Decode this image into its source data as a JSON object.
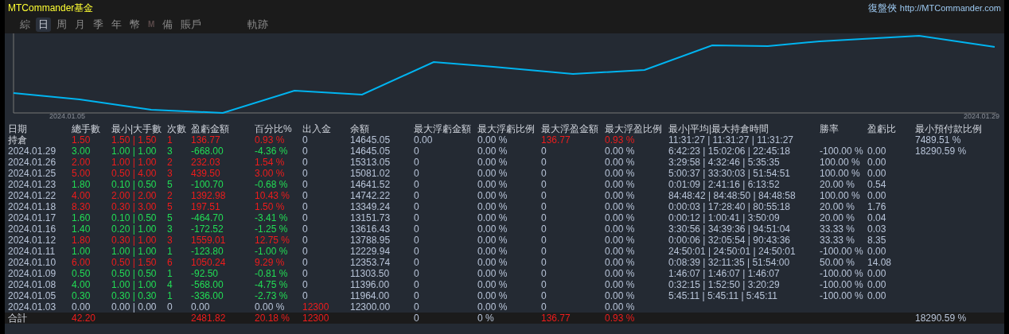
{
  "window": {
    "title": "MTCommander基金",
    "brand": "復盤俠",
    "url": "http://MTCommander.com"
  },
  "tabs": [
    {
      "label": "綜",
      "selected": false,
      "disabled": false
    },
    {
      "label": "日",
      "selected": true,
      "disabled": false
    },
    {
      "label": "周",
      "selected": false,
      "disabled": false
    },
    {
      "label": "月",
      "selected": false,
      "disabled": false
    },
    {
      "label": "季",
      "selected": false,
      "disabled": false
    },
    {
      "label": "年",
      "selected": false,
      "disabled": false
    },
    {
      "label": "幣",
      "selected": false,
      "disabled": false
    },
    {
      "label": "M",
      "selected": false,
      "disabled": true
    },
    {
      "label": "備",
      "selected": false,
      "disabled": false
    },
    {
      "label": "賬戶",
      "selected": false,
      "disabled": false
    }
  ],
  "extra_tabs": [
    {
      "label": "軌跡",
      "selected": false,
      "disabled": false
    }
  ],
  "chart": {
    "start_label": "2024.01.05",
    "end_label": "2024.01.29"
  },
  "table": {
    "columns": [
      "日期",
      "總手數",
      "最小|大手數",
      "次數",
      "盈虧金額",
      "百分比%",
      "出入金",
      "余額",
      "最大浮虧金額",
      "最大浮虧比例",
      "最大浮盈金額",
      "最大浮盈比例",
      "最小|平均|最大持倉時間",
      "勝率",
      "盈虧比",
      "最小預付款比例"
    ],
    "rows": [
      {
        "kind": "gain",
        "cash_flagged": false,
        "float_flagged": true,
        "cells": [
          "持倉",
          "1.50",
          "1.50 | 1.50",
          "1",
          "136.77",
          "0.93 %",
          "0",
          "14645.05",
          "0.00",
          "0.00 %",
          "136.77",
          "0.93 %",
          "11:31:27 | 11:31:27 | 11:31:27",
          null,
          null,
          "7489.51 %"
        ]
      },
      {
        "kind": "loss",
        "cash_flagged": false,
        "float_flagged": false,
        "cells": [
          "2024.01.29",
          "3.00",
          "1.00 | 1.00",
          "3",
          "-668.00",
          "-4.36 %",
          "0",
          "14645.05",
          "0",
          "0.00 %",
          "0",
          "0.00 %",
          "6:42:23 | 15:02:06 | 22:45:18",
          "-100.00 %",
          "0.00",
          "18290.59 %"
        ]
      },
      {
        "kind": "gain",
        "cash_flagged": false,
        "float_flagged": false,
        "cells": [
          "2024.01.26",
          "2.00",
          "1.00 | 1.00",
          "2",
          "232.03",
          "1.54 %",
          "0",
          "15313.05",
          "0",
          "0.00 %",
          "0",
          "0.00 %",
          "3:29:58 | 4:32:46 | 5:35:35",
          "100.00 %",
          "0.00",
          null
        ]
      },
      {
        "kind": "gain",
        "cash_flagged": false,
        "float_flagged": false,
        "cells": [
          "2024.01.25",
          "5.00",
          "0.50 | 4.00",
          "3",
          "439.50",
          "3.00 %",
          "0",
          "15081.02",
          "0",
          "0.00 %",
          "0",
          "0.00 %",
          "5:00:37 | 33:30:03 | 51:54:51",
          "100.00 %",
          "0.00",
          null
        ]
      },
      {
        "kind": "loss",
        "cash_flagged": false,
        "float_flagged": false,
        "cells": [
          "2024.01.23",
          "1.80",
          "0.10 | 0.50",
          "5",
          "-100.70",
          "-0.68 %",
          "0",
          "14641.52",
          "0",
          "0.00 %",
          "0",
          "0.00 %",
          "0:01:09 | 2:41:16 | 6:13:52",
          "20.00 %",
          "0.54",
          null
        ]
      },
      {
        "kind": "gain",
        "cash_flagged": false,
        "float_flagged": false,
        "cells": [
          "2024.01.22",
          "4.00",
          "2.00 | 2.00",
          "2",
          "1392.98",
          "10.43 %",
          "0",
          "14742.22",
          "0",
          "0.00 %",
          "0",
          "0.00 %",
          "84:48:42 | 84:48:50 | 84:48:58",
          "100.00 %",
          "0.00",
          null
        ]
      },
      {
        "kind": "gain",
        "cash_flagged": false,
        "float_flagged": false,
        "cells": [
          "2024.01.18",
          "8.30",
          "0.30 | 3.00",
          "5",
          "197.51",
          "1.50 %",
          "0",
          "13349.24",
          "0",
          "0.00 %",
          "0",
          "0.00 %",
          "0:00:03 | 17:28:40 | 80:55:18",
          "20.00 %",
          "1.76",
          null
        ]
      },
      {
        "kind": "loss",
        "cash_flagged": false,
        "float_flagged": false,
        "cells": [
          "2024.01.17",
          "1.60",
          "0.10 | 0.50",
          "5",
          "-464.70",
          "-3.41 %",
          "0",
          "13151.73",
          "0",
          "0.00 %",
          "0",
          "0.00 %",
          "0:00:12 | 1:00:41 | 3:50:09",
          "20.00 %",
          "0.04",
          null
        ]
      },
      {
        "kind": "loss",
        "cash_flagged": false,
        "float_flagged": false,
        "cells": [
          "2024.01.16",
          "1.40",
          "0.20 | 1.00",
          "3",
          "-172.52",
          "-1.25 %",
          "0",
          "13616.43",
          "0",
          "0.00 %",
          "0",
          "0.00 %",
          "3:30:56 | 34:39:36 | 94:51:04",
          "33.33 %",
          "0.03",
          null
        ]
      },
      {
        "kind": "gain",
        "cash_flagged": false,
        "float_flagged": false,
        "cells": [
          "2024.01.12",
          "1.80",
          "0.30 | 1.00",
          "3",
          "1559.01",
          "12.75 %",
          "0",
          "13788.95",
          "0",
          "0.00 %",
          "0",
          "0.00 %",
          "0:00:06 | 32:05:54 | 90:43:36",
          "33.33 %",
          "8.35",
          null
        ]
      },
      {
        "kind": "loss",
        "cash_flagged": false,
        "float_flagged": false,
        "cells": [
          "2024.01.11",
          "1.00",
          "1.00 | 1.00",
          "1",
          "-123.80",
          "-1.00 %",
          "0",
          "12229.94",
          "0",
          "0.00 %",
          "0",
          "0.00 %",
          "24:50:01 | 24:50:01 | 24:50:01",
          "-100.00 %",
          "0.00",
          null
        ]
      },
      {
        "kind": "gain",
        "cash_flagged": false,
        "float_flagged": false,
        "cells": [
          "2024.01.10",
          "6.00",
          "0.50 | 1.50",
          "6",
          "1050.24",
          "9.29 %",
          "0",
          "12353.74",
          "0",
          "0.00 %",
          "0",
          "0.00 %",
          "0:08:39 | 32:11:35 | 51:54:00",
          "50.00 %",
          "14.08",
          null
        ]
      },
      {
        "kind": "loss",
        "cash_flagged": false,
        "float_flagged": false,
        "cells": [
          "2024.01.09",
          "0.50",
          "0.50 | 0.50",
          "1",
          "-92.50",
          "-0.81 %",
          "0",
          "11303.50",
          "0",
          "0.00 %",
          "0",
          "0.00 %",
          "1:46:07 | 1:46:07 | 1:46:07",
          "-100.00 %",
          "0.00",
          null
        ]
      },
      {
        "kind": "loss",
        "cash_flagged": false,
        "float_flagged": false,
        "cells": [
          "2024.01.08",
          "4.00",
          "1.00 | 1.00",
          "4",
          "-568.00",
          "-4.75 %",
          "0",
          "11396.00",
          "0",
          "0.00 %",
          "0",
          "0.00 %",
          "0:32:15 | 1:52:50 | 3:20:29",
          "-100.00 %",
          "0.00",
          null
        ]
      },
      {
        "kind": "loss",
        "cash_flagged": false,
        "float_flagged": false,
        "cells": [
          "2024.01.05",
          "0.30",
          "0.30 | 0.30",
          "1",
          "-336.00",
          "-2.73 %",
          "0",
          "11964.00",
          "0",
          "0.00 %",
          "0",
          "0.00 %",
          "5:45:11 | 5:45:11 | 5:45:11",
          "-100.00 %",
          "0.00",
          null
        ]
      },
      {
        "kind": "flat",
        "cash_flagged": true,
        "float_flagged": false,
        "cells": [
          "2024.01.03",
          "0.00",
          "0.00 | 0.00",
          "0",
          "0.00",
          "0.00 %",
          "12300",
          "12300.00",
          "0",
          "0.00 %",
          "0",
          "0.00 %",
          null,
          null,
          null,
          null
        ]
      }
    ],
    "total": {
      "kind": "gain",
      "cash_flagged": true,
      "float_flagged": true,
      "cells": [
        "合計",
        "42.20",
        null,
        null,
        "2481.82",
        "20.18 %",
        "12300",
        null,
        "0",
        "0 %",
        "136.77",
        "0.93 %",
        null,
        null,
        null,
        "18290.59 %"
      ]
    }
  }
}
